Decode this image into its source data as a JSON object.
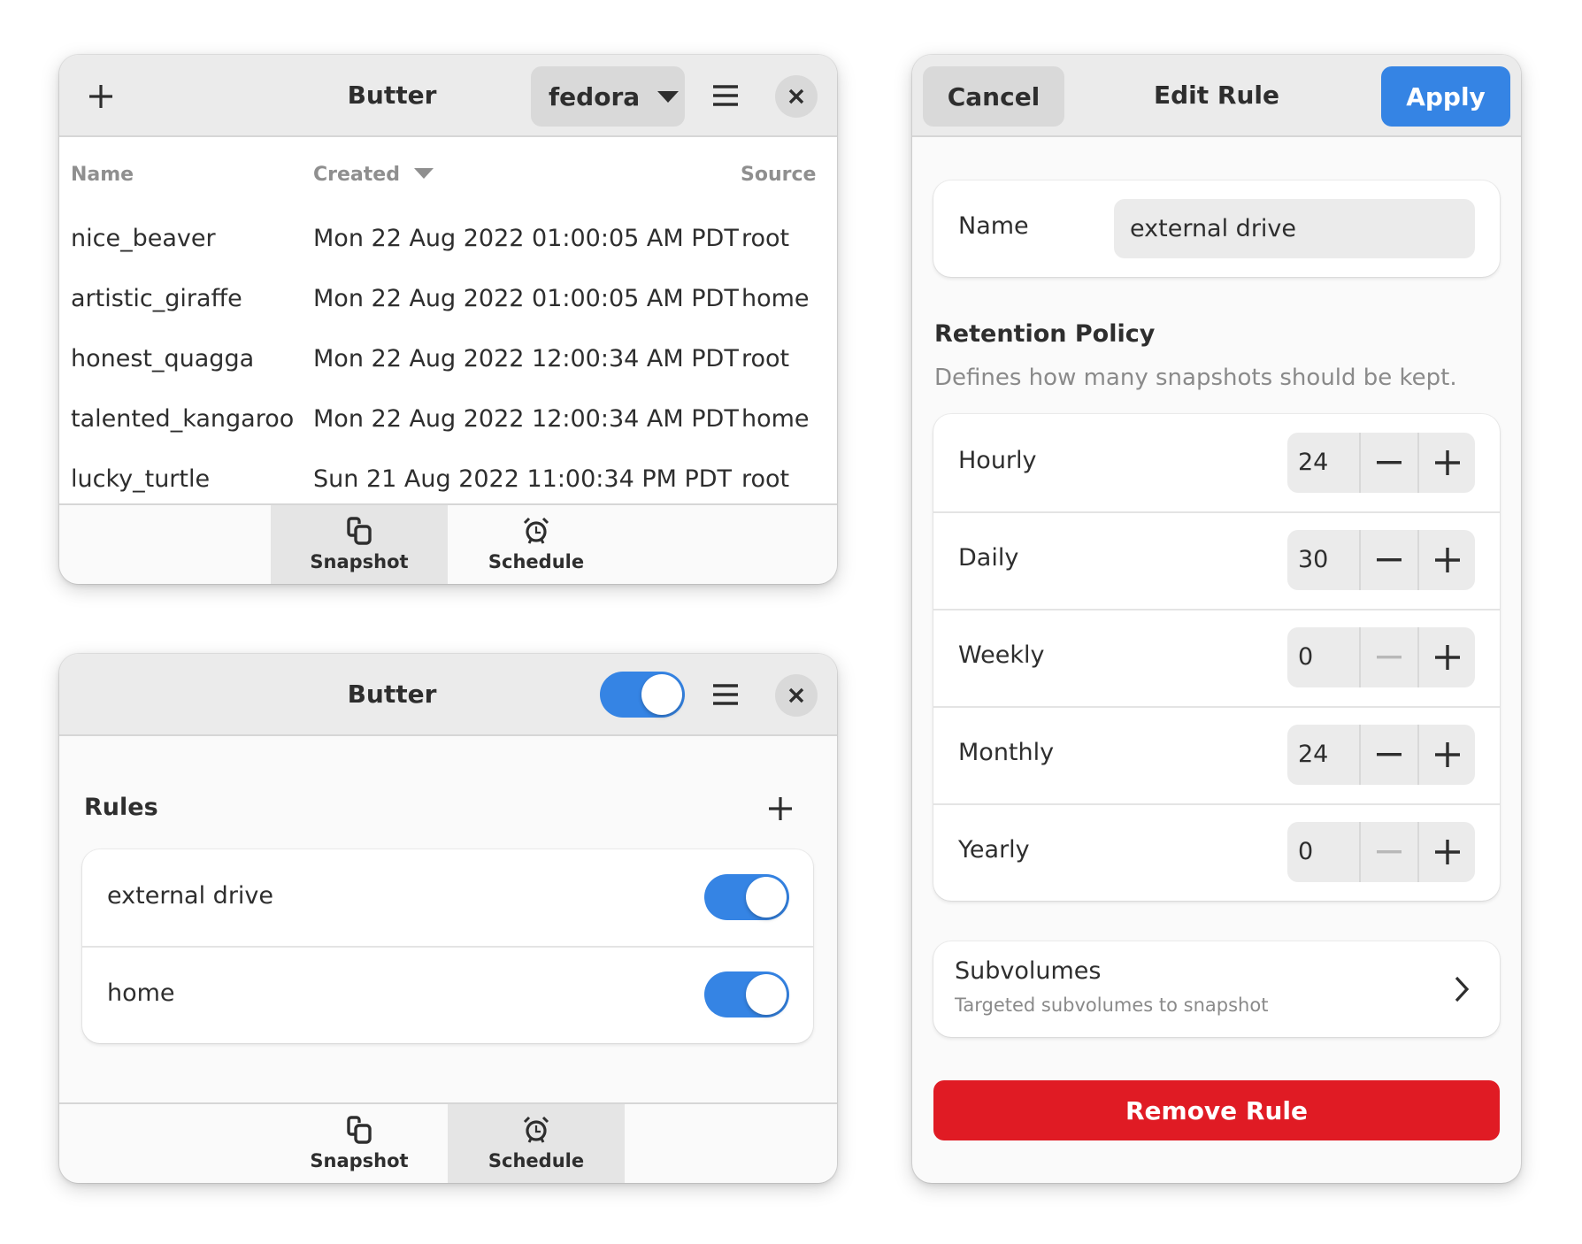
{
  "colors": {
    "accent": "#3584e4",
    "destructive": "#e01b24",
    "headerbar": "#ebebeb",
    "window_bg": "#fafafa",
    "dim_text": "#8f8f8f"
  },
  "snapshots_window": {
    "header": {
      "add_icon": "plus-icon",
      "title": "Butter",
      "subvolume_dropdown": {
        "selected": "fedora",
        "icon": "triangle-down-icon"
      },
      "menu_icon": "hamburger-menu-icon",
      "close_icon": "close-icon"
    },
    "table": {
      "columns": [
        {
          "label": "Name"
        },
        {
          "label": "Created",
          "sort": "descending"
        },
        {
          "label": "Source"
        }
      ],
      "rows": [
        {
          "name": "nice_beaver",
          "created": "Mon 22 Aug 2022 01:00:05 AM PDT",
          "source": "root"
        },
        {
          "name": "artistic_giraffe",
          "created": "Mon 22 Aug 2022 01:00:05 AM PDT",
          "source": "home"
        },
        {
          "name": "honest_quagga",
          "created": "Mon 22 Aug 2022 12:00:34 AM PDT",
          "source": "root"
        },
        {
          "name": "talented_kangaroo",
          "created": "Mon 22 Aug 2022 12:00:34 AM PDT",
          "source": "home"
        },
        {
          "name": "lucky_turtle",
          "created": "Sun 21 Aug 2022 11:00:34 PM PDT",
          "source": "root"
        }
      ]
    },
    "bottom_nav": {
      "tabs": [
        {
          "label": "Snapshot",
          "icon": "snapshot-icon",
          "active": true
        },
        {
          "label": "Schedule",
          "icon": "alarm-clock-icon",
          "active": false
        }
      ]
    }
  },
  "schedule_window": {
    "header": {
      "title": "Butter",
      "schedule_enabled": true,
      "menu_icon": "hamburger-menu-icon",
      "close_icon": "close-icon"
    },
    "rules": {
      "heading": "Rules",
      "add_icon": "plus-icon",
      "items": [
        {
          "label": "external drive",
          "enabled": true
        },
        {
          "label": "home",
          "enabled": true
        }
      ]
    },
    "bottom_nav": {
      "tabs": [
        {
          "label": "Snapshot",
          "icon": "snapshot-icon",
          "active": false
        },
        {
          "label": "Schedule",
          "icon": "alarm-clock-icon",
          "active": true
        }
      ]
    }
  },
  "edit_rule_window": {
    "header": {
      "cancel_label": "Cancel",
      "title": "Edit Rule",
      "apply_label": "Apply"
    },
    "name_field": {
      "label": "Name",
      "value": "external drive"
    },
    "retention": {
      "title": "Retention Policy",
      "subtitle": "Defines how many snapshots should be kept.",
      "rows": [
        {
          "label": "Hourly",
          "value": "24",
          "minus_enabled": true
        },
        {
          "label": "Daily",
          "value": "30",
          "minus_enabled": true
        },
        {
          "label": "Weekly",
          "value": "0",
          "minus_enabled": false
        },
        {
          "label": "Monthly",
          "value": "24",
          "minus_enabled": true
        },
        {
          "label": "Yearly",
          "value": "0",
          "minus_enabled": false
        }
      ]
    },
    "subvolumes": {
      "title": "Subvolumes",
      "subtitle": "Targeted subvolumes to snapshot",
      "icon": "chevron-right-icon"
    },
    "remove_label": "Remove Rule"
  }
}
